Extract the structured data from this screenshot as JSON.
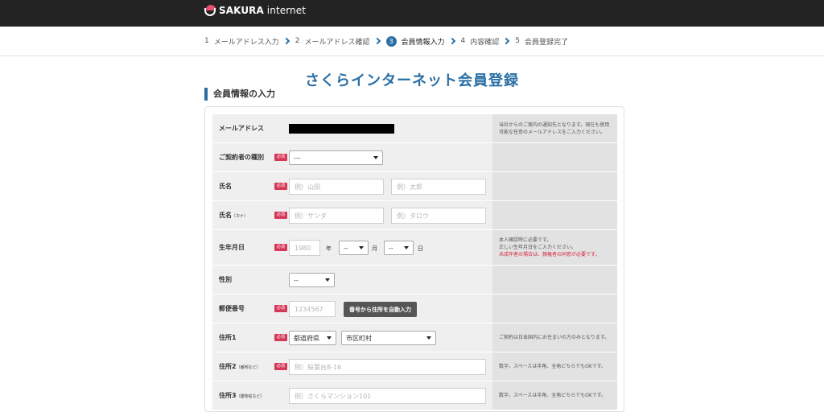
{
  "header": {
    "brand_bold": "SAKURA",
    "brand_rest": " internet",
    "colors": {
      "bar": "#232323",
      "logo_pink": "#e8506c"
    }
  },
  "steps": [
    {
      "num": "1",
      "label": "メールアドレス入力",
      "active": false
    },
    {
      "num": "2",
      "label": "メールアドレス確認",
      "active": false
    },
    {
      "num": "3",
      "label": "会員情報入力",
      "active": true
    },
    {
      "num": "4",
      "label": "内容確認",
      "active": false
    },
    {
      "num": "5",
      "label": "会員登録完了",
      "active": false
    }
  ],
  "page_title": "さくらインターネット会員登録",
  "section_heading": "会員情報の入力",
  "required_badge": "必須",
  "form": {
    "email": {
      "label": "メールアドレス",
      "note": "当社からのご案内の通知先となります。現在も使用可能な任意のメールアドレスをご入力ください。"
    },
    "contract_type": {
      "label": "ご契約者の種別",
      "selected": "---"
    },
    "name": {
      "label": "氏名",
      "last_placeholder": "例）山田",
      "first_placeholder": "例）太郎"
    },
    "name_kana": {
      "label": "氏名",
      "label_suffix": "（カナ）",
      "last_placeholder": "例）サンダ",
      "first_placeholder": "例）タロウ"
    },
    "birthdate": {
      "label": "生年月日",
      "year_placeholder": "1980",
      "year_unit": "年",
      "month_selected": "--",
      "month_unit": "月",
      "day_selected": "--",
      "day_unit": "日",
      "note_line1": "本人確認時に必要です。",
      "note_line2": "正しい生年月日をご入力ください。",
      "note_red": "未成年者の場合は、親権者の同意が必要です。"
    },
    "gender": {
      "label": "性別",
      "selected": "--"
    },
    "postal": {
      "label": "郵便番号",
      "placeholder": "1234567",
      "autofill_button": "番号から住所を自動入力"
    },
    "address1": {
      "label": "住所1",
      "prefecture_selected": "都道府県",
      "city_selected": "市区町村",
      "note": "ご契約は日本国内にお住まいの方のみとなります。"
    },
    "address2": {
      "label": "住所2",
      "label_suffix": "（番地など）",
      "placeholder": "例）桜葉台8-16",
      "note": "数字、スペースは半角、全角どちらでもOKです。"
    },
    "address3": {
      "label": "住所3",
      "label_suffix": "（建物名など）",
      "placeholder": "例）さくらマンション101",
      "note": "数字、スペースは半角、全角どちらでもOKです。"
    }
  }
}
